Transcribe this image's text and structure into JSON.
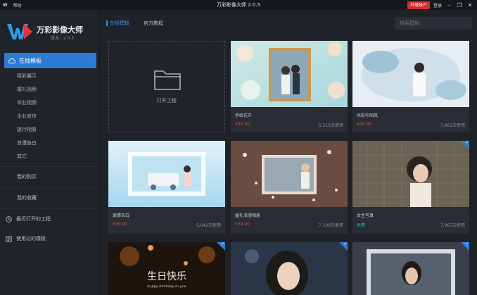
{
  "titlebar": {
    "logo": "W",
    "menu_help": "帮助",
    "title": "万彩影像大师 2.0.5",
    "upgrade": "升级账户",
    "login": "登录",
    "min": "–",
    "restore": "❐",
    "close": "✕"
  },
  "sidebar": {
    "brand_name": "万彩影像大师",
    "brand_version": "版本：2.0.5",
    "active_item": "在线模板",
    "sub_items": [
      "精彩展示",
      "婚礼视频",
      "毕业视频",
      "企业宣传",
      "旅行相册",
      "浪漫告白",
      "其它"
    ],
    "my_works": "我的购买",
    "my_favorites": "我的收藏",
    "recent_projects": "最近打开的工程",
    "used_templates": "使用过的模板"
  },
  "main": {
    "tabs": [
      "在线模板",
      "官方教程"
    ],
    "search_placeholder": "搜索模板",
    "open_project_label": "打开工程",
    "cards": [
      {
        "name": "手绘花卉",
        "price": "¥39.90",
        "uses": "5,315次使用",
        "corner": false
      },
      {
        "name": "水彩中国风",
        "price": "¥49.90",
        "uses": "7,661次使用",
        "corner": false
      },
      {
        "name": "爱情告白",
        "price": "¥39.90",
        "uses": "5,042次使用",
        "corner": false
      },
      {
        "name": "婚礼浪漫相册",
        "price": "¥39.90",
        "uses": "7,109次使用",
        "corner": false
      },
      {
        "name": "女生写真",
        "price": "免费",
        "uses": "7,067次使用",
        "corner": true
      },
      {
        "name": "",
        "price": "",
        "uses": "",
        "corner": true
      },
      {
        "name": "",
        "price": "",
        "uses": "",
        "corner": true
      },
      {
        "name": "",
        "price": "",
        "uses": "",
        "corner": true
      }
    ],
    "birthday_text": "生日快乐",
    "birthday_sub": "happy birthday to you"
  },
  "colors": {
    "accent": "#2e7bd6",
    "upgrade": "#d82c2c",
    "price": "#e04a3a",
    "free": "#1fbfa0"
  }
}
